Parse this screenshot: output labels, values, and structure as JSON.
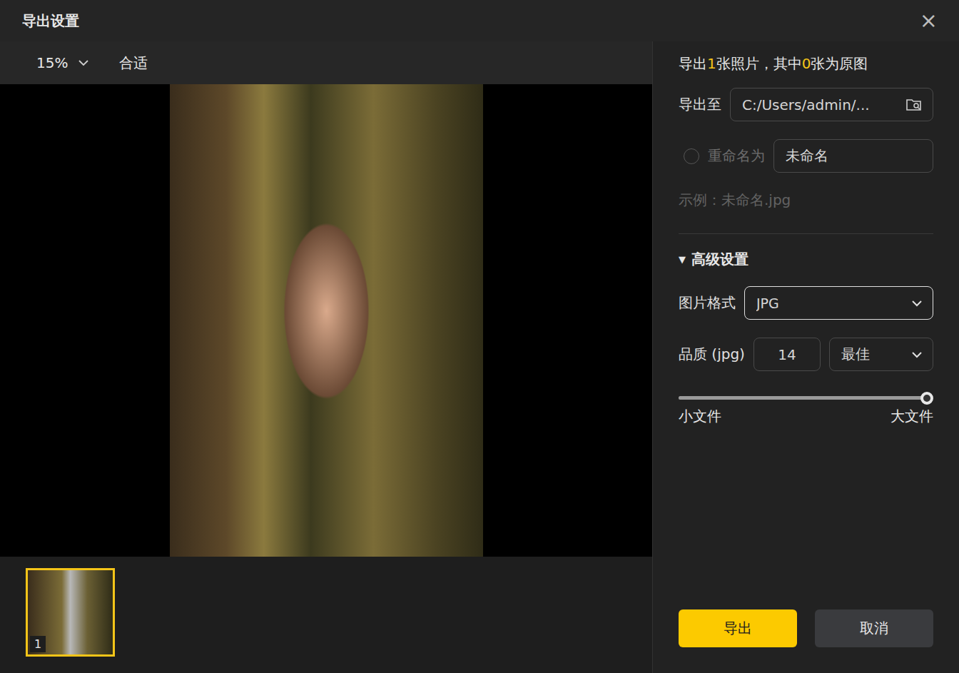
{
  "window": {
    "title": "导出设置",
    "close": "×"
  },
  "preview": {
    "zoom": "15%",
    "fit": "合适",
    "thumbnails": [
      {
        "index": "1",
        "selected": true
      }
    ]
  },
  "summary": {
    "parts": [
      {
        "text": "导出",
        "highlight": false
      },
      {
        "text": "1",
        "highlight": true
      },
      {
        "text": "张照片，其中",
        "highlight": false
      },
      {
        "text": "0",
        "highlight": true
      },
      {
        "text": "张为原图",
        "highlight": false
      }
    ]
  },
  "export_to": {
    "label": "导出至",
    "path": "C:/Users/admin/..."
  },
  "rename": {
    "label": "重命名为",
    "checked": false,
    "disabled": true,
    "value": "未命名"
  },
  "example": "示例：未命名.jpg",
  "advanced": {
    "label": "高级设置",
    "icon": "▼",
    "expanded": true,
    "format": {
      "label": "图片格式",
      "value": "JPG"
    },
    "quality": {
      "label": "品质 (jpg)",
      "value": "14",
      "preset": "最佳",
      "level": 1,
      "min_label": "小文件",
      "max_label": "大文件"
    }
  },
  "buttons": [
    {
      "label": "导出",
      "kind": "primary"
    },
    {
      "label": "取消",
      "kind": "secondary"
    }
  ]
}
